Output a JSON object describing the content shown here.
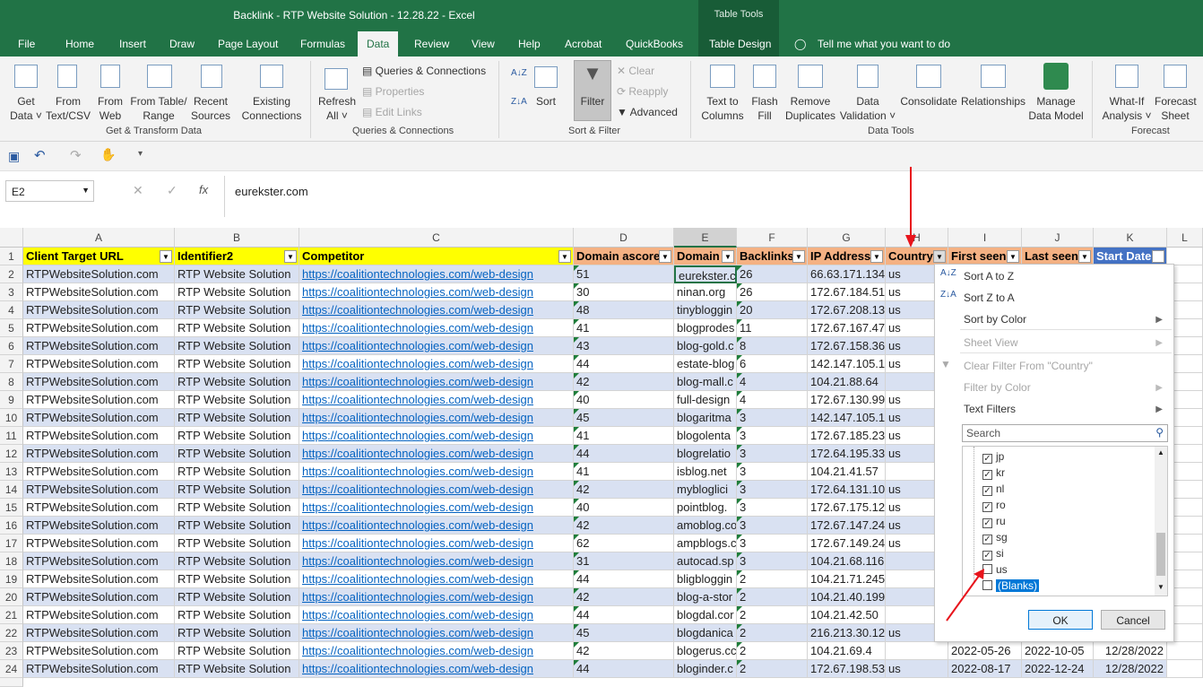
{
  "window": {
    "title": "Backlink - RTP Website Solution - 12.28.22  -  Excel",
    "table_tools_label": "Table Tools"
  },
  "tabs": [
    "File",
    "Home",
    "Insert",
    "Draw",
    "Page Layout",
    "Formulas",
    "Data",
    "Review",
    "View",
    "Help",
    "Acrobat",
    "QuickBooks",
    "Table Design"
  ],
  "tell_me": "Tell me what you want to do",
  "ribbon": {
    "get_data": [
      "Get",
      "Data"
    ],
    "from_text": [
      "From",
      "Text/CSV"
    ],
    "from_web": [
      "From",
      "Web"
    ],
    "from_table": [
      "From Table/",
      "Range"
    ],
    "recent_sources": [
      "Recent",
      "Sources"
    ],
    "existing_connections": [
      "Existing",
      "Connections"
    ],
    "refresh_all": [
      "Refresh",
      "All"
    ],
    "queries_connections": "Queries & Connections",
    "properties": "Properties",
    "edit_links": "Edit Links",
    "sort": "Sort",
    "filter": "Filter",
    "clear": "Clear",
    "reapply": "Reapply",
    "advanced": "Advanced",
    "text_to_columns": [
      "Text to",
      "Columns"
    ],
    "flash_fill": [
      "Flash",
      "Fill"
    ],
    "remove_duplicates": [
      "Remove",
      "Duplicates"
    ],
    "data_validation": [
      "Data",
      "Validation"
    ],
    "consolidate": "Consolidate",
    "relationships": "Relationships",
    "manage_data_model": [
      "Manage",
      "Data Model"
    ],
    "what_if": [
      "What-If",
      "Analysis"
    ],
    "forecast_sheet": [
      "Forecast",
      "Sheet"
    ],
    "groups": [
      "Get & Transform Data",
      "Queries & Connections",
      "Sort & Filter",
      "Data Tools",
      "Forecast"
    ]
  },
  "formula_bar": {
    "name_box": "E2",
    "value": "eurekster.com"
  },
  "columns": [
    "A",
    "B",
    "C",
    "D",
    "E",
    "F",
    "G",
    "H",
    "I",
    "J",
    "K",
    "L"
  ],
  "headers": [
    "Client Target URL",
    "Identifier2",
    "Competitor",
    "Domain ascore",
    "Domain",
    "Backlinks",
    "IP Address",
    "Country",
    "First seen",
    "Last seen",
    "Start Date"
  ],
  "rows": [
    {
      "n": "2",
      "a": "RTPWebsiteSolution.com",
      "b": "RTP Website Solution",
      "c": "https://coalitiontechnologies.com/web-design",
      "d": "51",
      "e": "eurekster.c",
      "f": "26",
      "g": "66.63.171.134",
      "h": "us",
      "i": "",
      "j": "",
      "k": ""
    },
    {
      "n": "3",
      "a": "RTPWebsiteSolution.com",
      "b": "RTP Website Solution",
      "c": "https://coalitiontechnologies.com/web-design",
      "d": "30",
      "e": "ninan.org",
      "f": "26",
      "g": "172.67.184.51",
      "h": "us",
      "i": "",
      "j": "",
      "k": ""
    },
    {
      "n": "4",
      "a": "RTPWebsiteSolution.com",
      "b": "RTP Website Solution",
      "c": "https://coalitiontechnologies.com/web-design",
      "d": "48",
      "e": "tinybloggin",
      "f": "20",
      "g": "172.67.208.13",
      "h": "us",
      "i": "",
      "j": "",
      "k": ""
    },
    {
      "n": "5",
      "a": "RTPWebsiteSolution.com",
      "b": "RTP Website Solution",
      "c": "https://coalitiontechnologies.com/web-design",
      "d": "41",
      "e": "blogprodes",
      "f": "11",
      "g": "172.67.167.47",
      "h": "us",
      "i": "",
      "j": "",
      "k": ""
    },
    {
      "n": "6",
      "a": "RTPWebsiteSolution.com",
      "b": "RTP Website Solution",
      "c": "https://coalitiontechnologies.com/web-design",
      "d": "43",
      "e": "blog-gold.c",
      "f": "8",
      "g": "172.67.158.36",
      "h": "us",
      "i": "",
      "j": "",
      "k": ""
    },
    {
      "n": "7",
      "a": "RTPWebsiteSolution.com",
      "b": "RTP Website Solution",
      "c": "https://coalitiontechnologies.com/web-design",
      "d": "44",
      "e": "estate-blog",
      "f": "6",
      "g": "142.147.105.1",
      "h": "us",
      "i": "",
      "j": "",
      "k": ""
    },
    {
      "n": "8",
      "a": "RTPWebsiteSolution.com",
      "b": "RTP Website Solution",
      "c": "https://coalitiontechnologies.com/web-design",
      "d": "42",
      "e": "blog-mall.c",
      "f": "4",
      "g": "104.21.88.64",
      "h": "",
      "i": "",
      "j": "",
      "k": ""
    },
    {
      "n": "9",
      "a": "RTPWebsiteSolution.com",
      "b": "RTP Website Solution",
      "c": "https://coalitiontechnologies.com/web-design",
      "d": "40",
      "e": "full-design",
      "f": "4",
      "g": "172.67.130.99",
      "h": "us",
      "i": "",
      "j": "",
      "k": ""
    },
    {
      "n": "10",
      "a": "RTPWebsiteSolution.com",
      "b": "RTP Website Solution",
      "c": "https://coalitiontechnologies.com/web-design",
      "d": "45",
      "e": "blogaritma",
      "f": "3",
      "g": "142.147.105.1",
      "h": "us",
      "i": "",
      "j": "",
      "k": ""
    },
    {
      "n": "11",
      "a": "RTPWebsiteSolution.com",
      "b": "RTP Website Solution",
      "c": "https://coalitiontechnologies.com/web-design",
      "d": "41",
      "e": "blogolenta",
      "f": "3",
      "g": "172.67.185.23",
      "h": "us",
      "i": "",
      "j": "",
      "k": ""
    },
    {
      "n": "12",
      "a": "RTPWebsiteSolution.com",
      "b": "RTP Website Solution",
      "c": "https://coalitiontechnologies.com/web-design",
      "d": "44",
      "e": "blogrelatio",
      "f": "3",
      "g": "172.64.195.33",
      "h": "us",
      "i": "",
      "j": "",
      "k": ""
    },
    {
      "n": "13",
      "a": "RTPWebsiteSolution.com",
      "b": "RTP Website Solution",
      "c": "https://coalitiontechnologies.com/web-design",
      "d": "41",
      "e": "isblog.net",
      "f": "3",
      "g": "104.21.41.57",
      "h": "",
      "i": "",
      "j": "",
      "k": ""
    },
    {
      "n": "14",
      "a": "RTPWebsiteSolution.com",
      "b": "RTP Website Solution",
      "c": "https://coalitiontechnologies.com/web-design",
      "d": "42",
      "e": "mybloglici",
      "f": "3",
      "g": "172.64.131.10",
      "h": "us",
      "i": "",
      "j": "",
      "k": ""
    },
    {
      "n": "15",
      "a": "RTPWebsiteSolution.com",
      "b": "RTP Website Solution",
      "c": "https://coalitiontechnologies.com/web-design",
      "d": "40",
      "e": "pointblog.",
      "f": "3",
      "g": "172.67.175.12",
      "h": "us",
      "i": "",
      "j": "",
      "k": ""
    },
    {
      "n": "16",
      "a": "RTPWebsiteSolution.com",
      "b": "RTP Website Solution",
      "c": "https://coalitiontechnologies.com/web-design",
      "d": "42",
      "e": "amoblog.co",
      "f": "3",
      "g": "172.67.147.24",
      "h": "us",
      "i": "",
      "j": "",
      "k": ""
    },
    {
      "n": "17",
      "a": "RTPWebsiteSolution.com",
      "b": "RTP Website Solution",
      "c": "https://coalitiontechnologies.com/web-design",
      "d": "62",
      "e": "ampblogs.c",
      "f": "3",
      "g": "172.67.149.24",
      "h": "us",
      "i": "",
      "j": "",
      "k": ""
    },
    {
      "n": "18",
      "a": "RTPWebsiteSolution.com",
      "b": "RTP Website Solution",
      "c": "https://coalitiontechnologies.com/web-design",
      "d": "31",
      "e": "autocad.sp",
      "f": "3",
      "g": "104.21.68.116",
      "h": "",
      "i": "",
      "j": "",
      "k": ""
    },
    {
      "n": "19",
      "a": "RTPWebsiteSolution.com",
      "b": "RTP Website Solution",
      "c": "https://coalitiontechnologies.com/web-design",
      "d": "44",
      "e": "bligbloggin",
      "f": "2",
      "g": "104.21.71.245",
      "h": "",
      "i": "",
      "j": "",
      "k": ""
    },
    {
      "n": "20",
      "a": "RTPWebsiteSolution.com",
      "b": "RTP Website Solution",
      "c": "https://coalitiontechnologies.com/web-design",
      "d": "42",
      "e": "blog-a-stor",
      "f": "2",
      "g": "104.21.40.199",
      "h": "",
      "i": "",
      "j": "",
      "k": ""
    },
    {
      "n": "21",
      "a": "RTPWebsiteSolution.com",
      "b": "RTP Website Solution",
      "c": "https://coalitiontechnologies.com/web-design",
      "d": "44",
      "e": "blogdal.cor",
      "f": "2",
      "g": "104.21.42.50",
      "h": "",
      "i": "",
      "j": "",
      "k": ""
    },
    {
      "n": "22",
      "a": "RTPWebsiteSolution.com",
      "b": "RTP Website Solution",
      "c": "https://coalitiontechnologies.com/web-design",
      "d": "45",
      "e": "blogdanica",
      "f": "2",
      "g": "216.213.30.12",
      "h": "us",
      "i": "",
      "j": "",
      "k": ""
    },
    {
      "n": "23",
      "a": "RTPWebsiteSolution.com",
      "b": "RTP Website Solution",
      "c": "https://coalitiontechnologies.com/web-design",
      "d": "42",
      "e": "blogerus.cc",
      "f": "2",
      "g": "104.21.69.4",
      "h": "",
      "i": "2022-05-26",
      "j": "2022-10-05",
      "k": "12/28/2022"
    },
    {
      "n": "24",
      "a": "RTPWebsiteSolution.com",
      "b": "RTP Website Solution",
      "c": "https://coalitiontechnologies.com/web-design",
      "d": "44",
      "e": "bloginder.c",
      "f": "2",
      "g": "172.67.198.53",
      "h": "us",
      "i": "2022-08-17",
      "j": "2022-12-24",
      "k": "12/28/2022"
    }
  ],
  "filter_menu": {
    "sort_az": "Sort A to Z",
    "sort_za": "Sort Z to A",
    "sort_color": "Sort by Color",
    "sheet_view": "Sheet View",
    "clear_filter": "Clear Filter From \"Country\"",
    "filter_color": "Filter by Color",
    "text_filters": "Text Filters",
    "search_placeholder": "Search",
    "items": [
      {
        "label": "jp",
        "checked": true
      },
      {
        "label": "kr",
        "checked": true
      },
      {
        "label": "nl",
        "checked": true
      },
      {
        "label": "ro",
        "checked": true
      },
      {
        "label": "ru",
        "checked": true
      },
      {
        "label": "sg",
        "checked": true
      },
      {
        "label": "si",
        "checked": true
      },
      {
        "label": "us",
        "checked": false
      },
      {
        "label": "(Blanks)",
        "checked": false
      }
    ],
    "ok": "OK",
    "cancel": "Cancel"
  },
  "colors": {
    "excel_green": "#217346",
    "header_yellow": "#ffff00",
    "header_salmon": "#f4b183",
    "header_blue": "#4472c4",
    "band_light": "#d9e1f2",
    "arrow_red": "#e8141c"
  }
}
